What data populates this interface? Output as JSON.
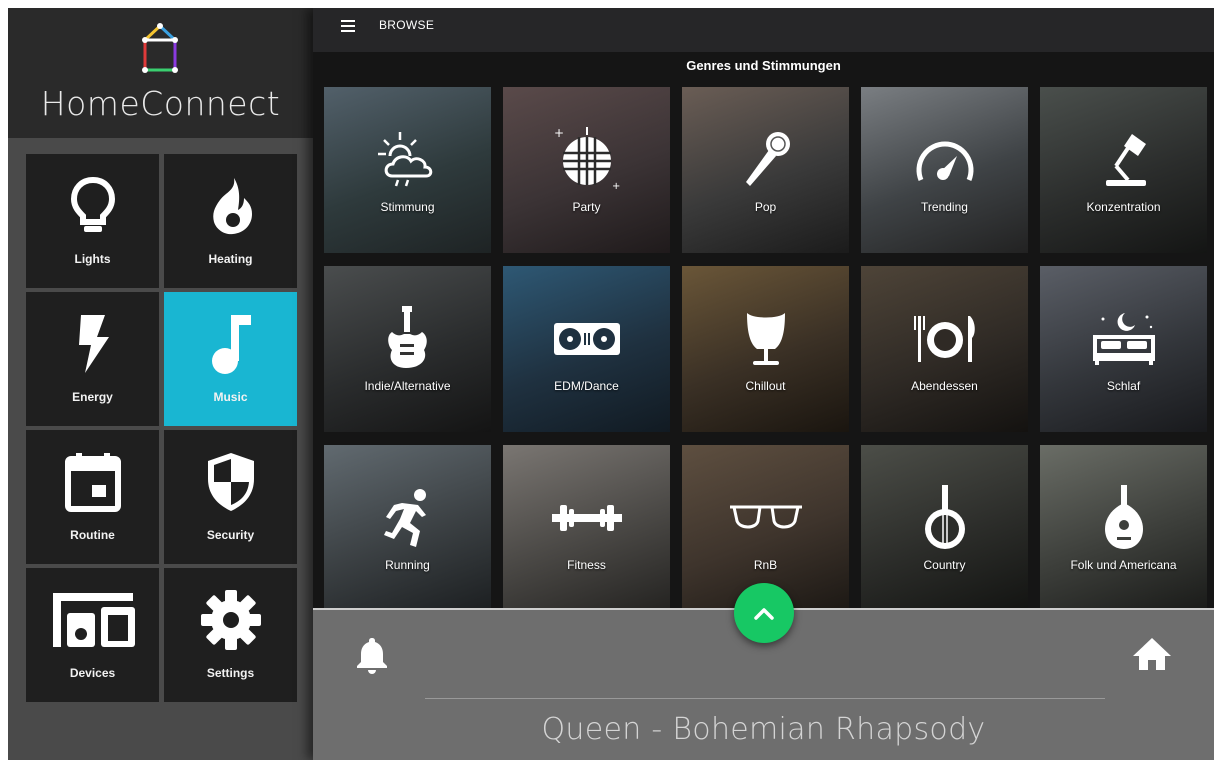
{
  "app": {
    "title": "HomeConnect",
    "logo_icon": "home-logo-icon",
    "accent_color": "#19b6d2"
  },
  "sidebar": {
    "items": [
      {
        "label": "Lights",
        "icon": "lightbulb-icon",
        "active": false
      },
      {
        "label": "Heating",
        "icon": "flame-icon",
        "active": false
      },
      {
        "label": "Energy",
        "icon": "lightning-icon",
        "active": false
      },
      {
        "label": "Music",
        "icon": "music-note-icon",
        "active": true
      },
      {
        "label": "Routine",
        "icon": "calendar-icon",
        "active": false
      },
      {
        "label": "Security",
        "icon": "shield-icon",
        "active": false
      },
      {
        "label": "Devices",
        "icon": "devices-icon",
        "active": false
      },
      {
        "label": "Settings",
        "icon": "gear-icon",
        "active": false
      }
    ]
  },
  "topbar": {
    "menu_icon": "hamburger-menu-icon",
    "title": "BROWSE"
  },
  "browse": {
    "section_title": "Genres und Stimmungen",
    "genres": [
      {
        "label": "Stimmung",
        "icon": "weather-icon",
        "bg": "#2e3a3c"
      },
      {
        "label": "Party",
        "icon": "disco-ball-icon",
        "bg": "#3b3335"
      },
      {
        "label": "Pop",
        "icon": "microphone-icon",
        "bg": "#3a3a3a"
      },
      {
        "label": "Trending",
        "icon": "gauge-icon",
        "bg": "#3f4346"
      },
      {
        "label": "Konzentration",
        "icon": "desk-lamp-icon",
        "bg": "#2b2d2c"
      },
      {
        "label": "Indie/Alternative",
        "icon": "electric-guitar-icon",
        "bg": "#2a2c2d"
      },
      {
        "label": "EDM/Dance",
        "icon": "turntables-icon",
        "bg": "#1f3140"
      },
      {
        "label": "Chillout",
        "icon": "egg-chair-icon",
        "bg": "#3a3025"
      },
      {
        "label": "Abendessen",
        "icon": "plate-cutlery-icon",
        "bg": "#2f2a25"
      },
      {
        "label": "Schlaf",
        "icon": "bed-moon-icon",
        "bg": "#33363b"
      },
      {
        "label": "Running",
        "icon": "runner-icon",
        "bg": "#3b4043"
      },
      {
        "label": "Fitness",
        "icon": "dumbbell-icon",
        "bg": "#4a4845"
      },
      {
        "label": "RnB",
        "icon": "sunglasses-icon",
        "bg": "#3e342c"
      },
      {
        "label": "Country",
        "icon": "banjo-icon",
        "bg": "#2c2d2a"
      },
      {
        "label": "Folk und Americana",
        "icon": "mandolin-icon",
        "bg": "#3d3f3b"
      }
    ]
  },
  "player": {
    "track": "Queen - Bohemian Rhapsody",
    "bell_icon": "bell-icon",
    "home_icon": "home-icon",
    "expand_icon": "chevron-up-icon",
    "fab_color": "#17c864"
  }
}
